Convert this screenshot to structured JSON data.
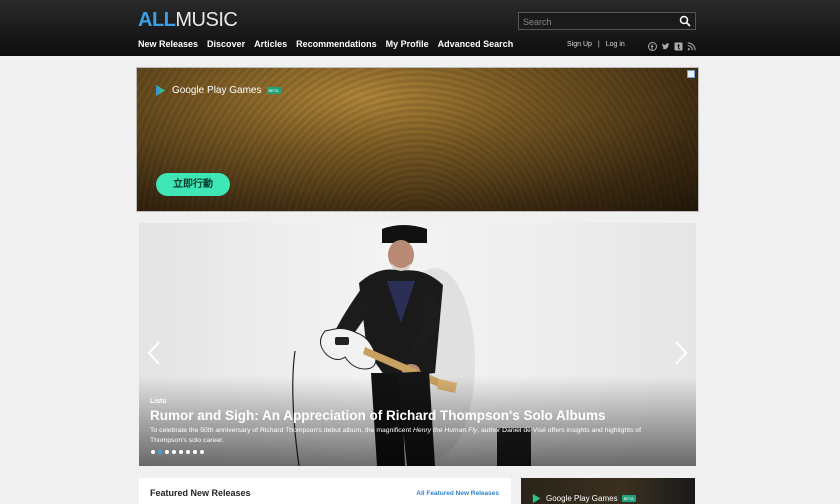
{
  "header": {
    "logo_all": "ALL",
    "logo_music": "MUSIC",
    "search_placeholder": "Search",
    "nav": [
      "New Releases",
      "Discover",
      "Articles",
      "Recommendations",
      "My Profile",
      "Advanced Search"
    ],
    "sign_up": "Sign Up",
    "separator": "|",
    "log_in": "Log in",
    "social_icons": [
      "facebook-icon",
      "twitter-icon",
      "tumblr-icon",
      "rss-icon"
    ]
  },
  "ad_banner": {
    "brand": "Google Play Games",
    "beta": "BETA",
    "cta": "立即行動"
  },
  "hero": {
    "category": "Lists",
    "title": "Rumor and Sigh: An Appreciation of Richard Thompson's Solo Albums",
    "description": "To celebrate the 50th anniversary of Richard Thompson's debut album, the magnificent Henry the Human Fly, author Daniel de Visé offers insights and highlights of Thompson's solo career.",
    "slide_count": 8,
    "active_slide": 2
  },
  "featured": {
    "title": "Featured New Releases",
    "link": "All Featured New Releases"
  },
  "side_ad": {
    "brand": "Google Play Games",
    "beta": "BETA"
  },
  "colors": {
    "accent": "#3aa0e8",
    "header_bg": "#111111",
    "cta_bg": "#3ee6b5"
  }
}
